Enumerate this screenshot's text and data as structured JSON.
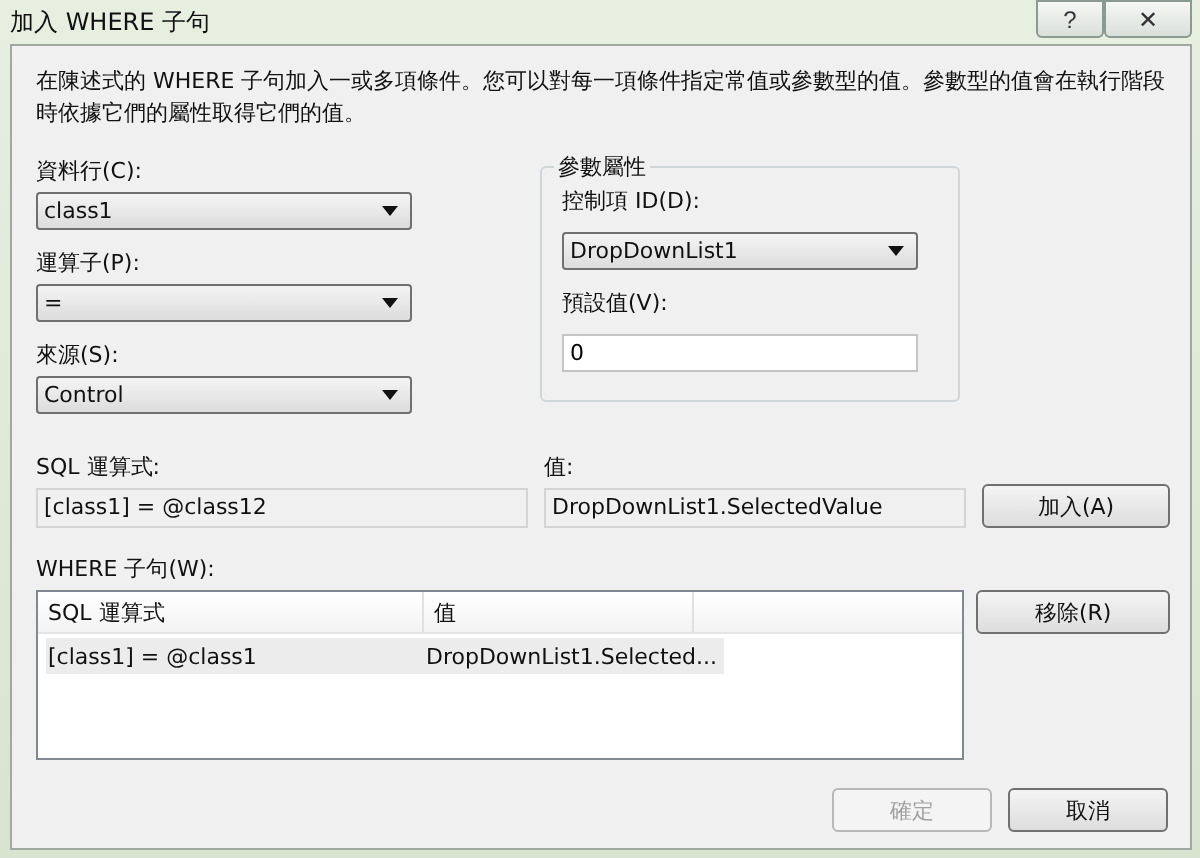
{
  "window": {
    "title": "加入 WHERE 子句",
    "help": "?",
    "close": "✕"
  },
  "description": "在陳述式的 WHERE 子句加入一或多項條件。您可以對每一項條件指定常值或參數型的值。參數型的值會在執行階段時依據它們的屬性取得它們的值。",
  "column": {
    "label": "資料行(C):",
    "value": "class1"
  },
  "operator": {
    "label": "運算子(P):",
    "value": "="
  },
  "source": {
    "label": "來源(S):",
    "value": "Control"
  },
  "parameter_properties": {
    "title": "參數屬性",
    "control_id": {
      "label": "控制項 ID(D):",
      "value": "DropDownList1"
    },
    "default_value": {
      "label": "預設值(V):",
      "value": "0"
    }
  },
  "sql_expression": {
    "label": "SQL 運算式:",
    "value": "[class1] = @class12"
  },
  "value": {
    "label": "值:",
    "value": "DropDownList1.SelectedValue"
  },
  "add_button": "加入(A)",
  "where_clause": {
    "label": "WHERE 子句(W):",
    "columns": [
      "SQL 運算式",
      "值"
    ],
    "rows": [
      {
        "cells": [
          "[class1] = @class1",
          "DropDownList1.Selected..."
        ],
        "selected": true
      }
    ]
  },
  "remove_button": "移除(R)",
  "ok_button": {
    "label": "確定",
    "disabled": true
  },
  "cancel_button": {
    "label": "取消",
    "disabled": false
  }
}
